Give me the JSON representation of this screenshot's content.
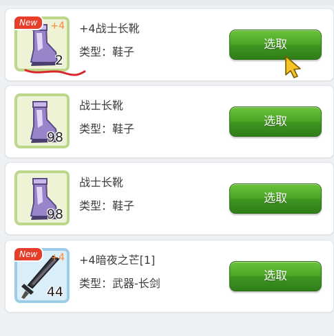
{
  "items": [
    {
      "new_badge": "New",
      "plus_badge": "+4",
      "count": "2",
      "name": "+4战士长靴",
      "type_text": "类型：鞋子",
      "button_label": "选取",
      "icon": "boot-icon",
      "frame": "green"
    },
    {
      "count": "98",
      "name": "战士长靴",
      "type_text": "类型：鞋子",
      "button_label": "选取",
      "icon": "boot-icon",
      "frame": "green"
    },
    {
      "count": "98",
      "name": "战士长靴",
      "type_text": "类型：鞋子",
      "button_label": "选取",
      "icon": "boot-icon",
      "frame": "green"
    },
    {
      "new_badge": "New",
      "plus_badge": "+4",
      "count": "44",
      "name": "+4暗夜之芒[1]",
      "type_text": "类型：武器-长剑",
      "button_label": "选取",
      "icon": "sword-icon",
      "frame": "blue"
    }
  ],
  "colors": {
    "button_green": "#4ba726",
    "new_badge_red": "#e53e2b",
    "plus_orange": "#f58a3a",
    "frame_green": "#bcd68a",
    "frame_blue": "#9ccde6",
    "cursor_yellow": "#f7c425",
    "annotation_red": "#d9262c"
  }
}
